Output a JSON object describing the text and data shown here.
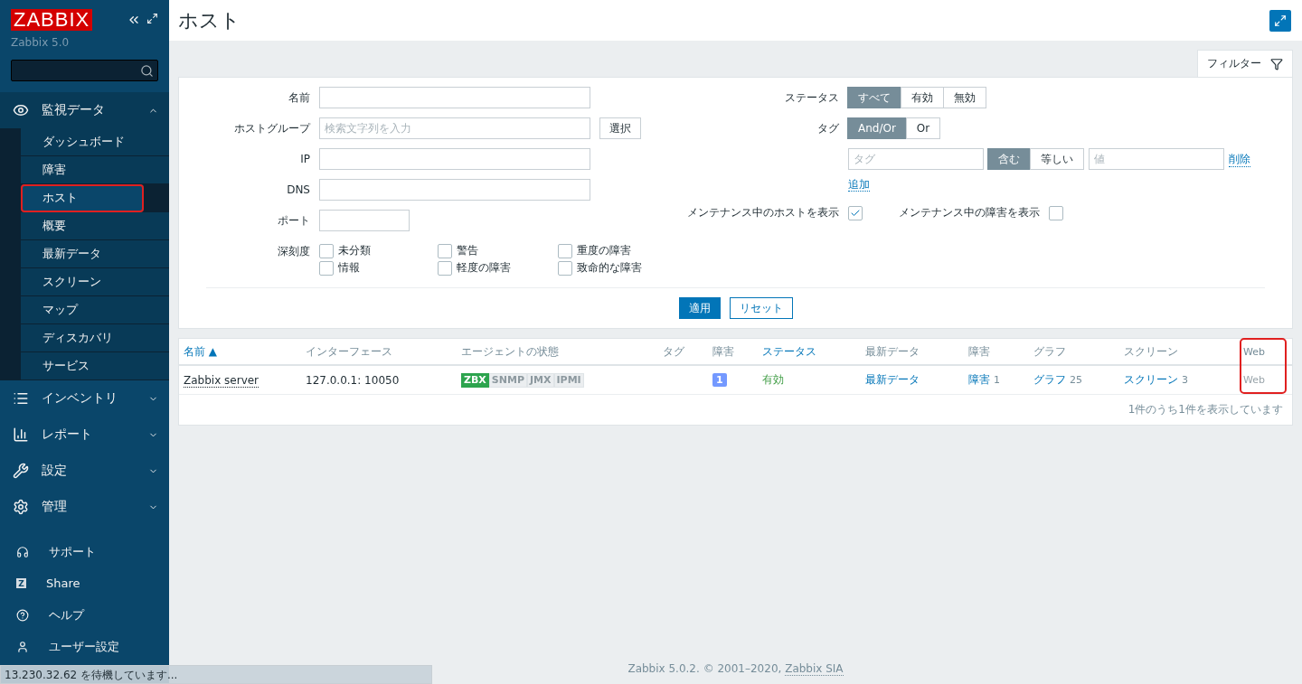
{
  "sidebar": {
    "logo": "ZABBIX",
    "version": "Zabbix 5.0",
    "menu": [
      {
        "label": "監視データ",
        "expanded": true,
        "children": [
          {
            "label": "ダッシュボード",
            "selected": false,
            "highlighted": false
          },
          {
            "label": "障害",
            "selected": false,
            "highlighted": false
          },
          {
            "label": "ホスト",
            "selected": true,
            "highlighted": true
          },
          {
            "label": "概要",
            "selected": false,
            "highlighted": false
          },
          {
            "label": "最新データ",
            "selected": false,
            "highlighted": false
          },
          {
            "label": "スクリーン",
            "selected": false,
            "highlighted": false
          },
          {
            "label": "マップ",
            "selected": false,
            "highlighted": false
          },
          {
            "label": "ディスカバリ",
            "selected": false,
            "highlighted": false
          },
          {
            "label": "サービス",
            "selected": false,
            "highlighted": false
          }
        ]
      },
      {
        "label": "インベントリ",
        "expanded": false
      },
      {
        "label": "レポート",
        "expanded": false
      },
      {
        "label": "設定",
        "expanded": false
      },
      {
        "label": "管理",
        "expanded": false
      }
    ],
    "bottom": [
      "サポート",
      "Share",
      "ヘルプ",
      "ユーザー設定"
    ],
    "share_icon": "Z"
  },
  "page": {
    "title": "ホスト"
  },
  "filter": {
    "tab": "フィルター",
    "left": [
      {
        "kind": "text",
        "label": "名前"
      },
      {
        "kind": "select",
        "label": "ホストグループ",
        "placeholder": "検索文字列を入力",
        "button": "選択"
      },
      {
        "kind": "text",
        "label": "IP"
      },
      {
        "kind": "text",
        "label": "DNS"
      },
      {
        "kind": "short",
        "label": "ポート"
      }
    ],
    "severity": {
      "label": "深刻度",
      "options": [
        {
          "label": "未分類",
          "checked": false
        },
        {
          "label": "情報",
          "checked": false
        },
        {
          "label": "警告",
          "checked": false
        },
        {
          "label": "軽度の障害",
          "checked": false
        },
        {
          "label": "重度の障害",
          "checked": false
        },
        {
          "label": "致命的な障害",
          "checked": false
        }
      ]
    },
    "status": {
      "label": "ステータス",
      "options": [
        {
          "label": "すべて",
          "selected": true
        },
        {
          "label": "有効",
          "selected": false
        },
        {
          "label": "無効",
          "selected": false
        }
      ]
    },
    "tags": {
      "label": "タグ",
      "operator": [
        {
          "label": "And/Or",
          "selected": true
        },
        {
          "label": "Or",
          "selected": false
        }
      ],
      "tag_placeholder": "タグ",
      "match": [
        {
          "label": "含む",
          "selected": true
        },
        {
          "label": "等しい",
          "selected": false
        }
      ],
      "value_placeholder": "値",
      "remove": "削除",
      "add": "追加"
    },
    "maintenance": [
      {
        "label": "メンテナンス中のホストを表示",
        "checked": true
      },
      {
        "label": "メンテナンス中の障害を表示",
        "checked": false
      }
    ],
    "apply": "適用",
    "reset": "リセット"
  },
  "table": {
    "columns": [
      {
        "label": "名前",
        "sort_mark": "▲",
        "link": true,
        "highlighted": false
      },
      {
        "label": "インターフェース",
        "link": false,
        "highlighted": false
      },
      {
        "label": "エージェントの状態",
        "link": false,
        "highlighted": false
      },
      {
        "label": "タグ",
        "link": false,
        "highlighted": false
      },
      {
        "label": "障害",
        "link": false,
        "highlighted": false
      },
      {
        "label": "ステータス",
        "link": true,
        "highlighted": false
      },
      {
        "label": "最新データ",
        "link": false,
        "highlighted": false
      },
      {
        "label": "障害",
        "link": false,
        "highlighted": false
      },
      {
        "label": "グラフ",
        "link": false,
        "highlighted": false
      },
      {
        "label": "スクリーン",
        "link": false,
        "highlighted": false
      },
      {
        "label": "Web",
        "link": false,
        "highlighted": true
      }
    ],
    "rows": [
      {
        "name": "Zabbix server",
        "interface": "127.0.0.1: 10050",
        "agents": [
          {
            "label": "ZBX",
            "available": true
          },
          {
            "label": "SNMP",
            "available": false
          },
          {
            "label": "JMX",
            "available": false
          },
          {
            "label": "IPMI",
            "available": false
          }
        ],
        "problems": "1",
        "status": "有効",
        "latest": "最新データ",
        "problem_link": "障害",
        "problem_count": "1",
        "graph_link": "グラフ",
        "graph_count": "25",
        "screen_link": "スクリーン",
        "screen_count": "3",
        "web": "Web",
        "web_enabled": false
      }
    ],
    "summary": "1件のうち1件を表示しています"
  },
  "footer": {
    "text": "Zabbix 5.0.2. © 2001–2020, ",
    "link": "Zabbix SIA"
  },
  "browser_status": "13.230.32.62 を待機しています..."
}
